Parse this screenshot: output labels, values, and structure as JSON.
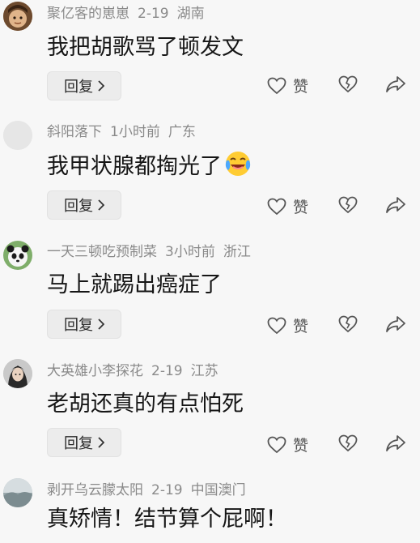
{
  "comments": [
    {
      "username": "聚亿客的崽崽",
      "date": "2-19",
      "location": "湖南",
      "text": "我把胡歌骂了顿发文",
      "reply_label": "回复",
      "like_label": "赞",
      "avatar": "cartoon-face-avatar"
    },
    {
      "username": "斜阳落下",
      "date": "1小时前",
      "location": "广东",
      "text": "我甲状腺都掏光了",
      "emoji": "laughing-crying-emoji",
      "reply_label": "回复",
      "like_label": "赞",
      "avatar": "blank-avatar"
    },
    {
      "username": "一天三顿吃预制菜",
      "date": "3小时前",
      "location": "浙江",
      "text": "马上就踢出癌症了",
      "reply_label": "回复",
      "like_label": "赞",
      "avatar": "panda-avatar"
    },
    {
      "username": "大英雄小李探花",
      "date": "2-19",
      "location": "江苏",
      "text": "老胡还真的有点怕死",
      "reply_label": "回复",
      "like_label": "赞",
      "avatar": "person-avatar"
    },
    {
      "username": "剥开乌云朦太阳",
      "date": "2-19",
      "location": "中国澳门",
      "text": "真矫情！结节算个屁啊！",
      "avatar": "landscape-avatar"
    }
  ],
  "colors": {
    "background": "#f7f7f7",
    "meta_text": "#8a8a8a",
    "body_text": "#161616",
    "reply_bg": "#ececec",
    "icon": "#555555"
  }
}
